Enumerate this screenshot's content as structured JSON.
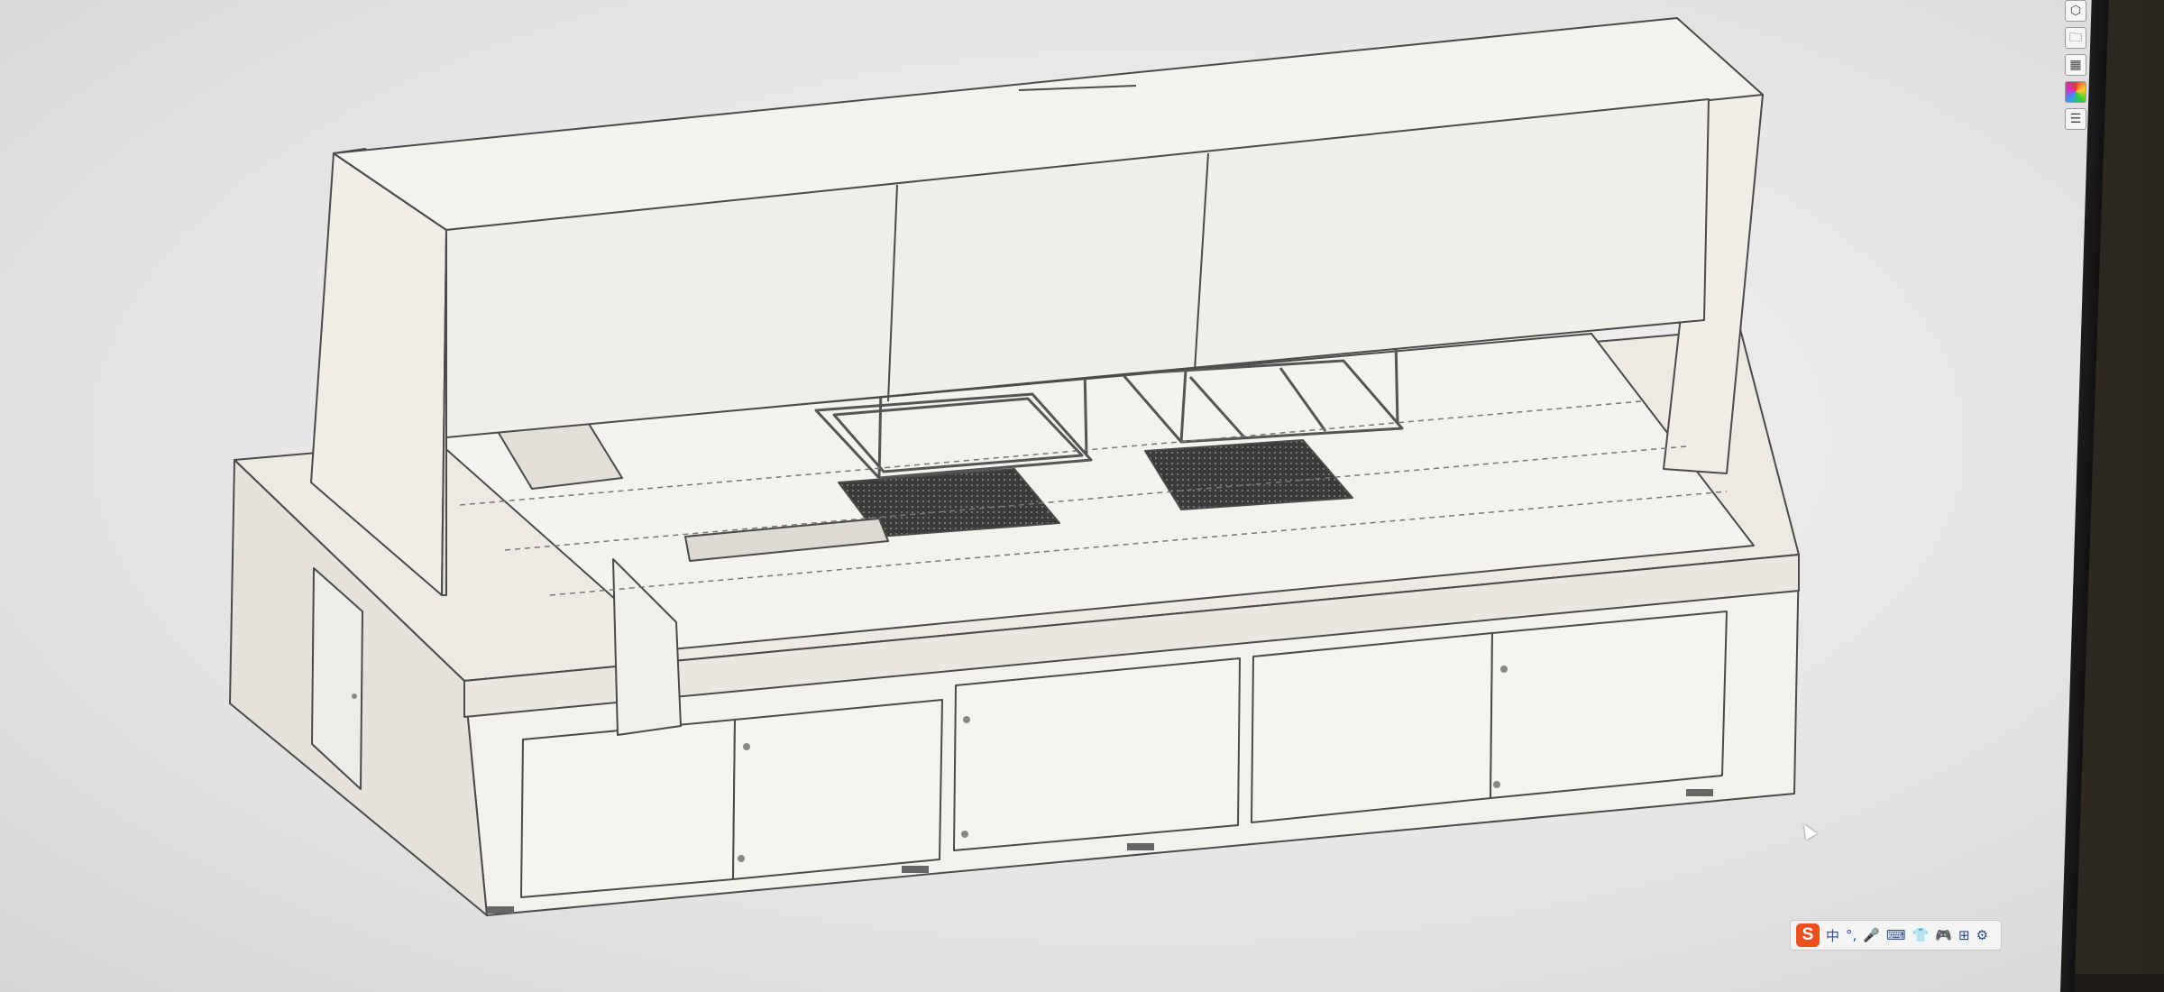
{
  "app": {
    "title": "",
    "viewport_background": "#e8e8e8",
    "model_fill": "#eceae3",
    "model_stroke": "#4a4a4a",
    "grate_fill": "#333333"
  },
  "toolbar": {
    "items": [
      {
        "icon": "cube-view-icon",
        "glyph": "⬡"
      },
      {
        "icon": "open-folder-icon",
        "glyph": "🗀"
      },
      {
        "icon": "render-settings-icon",
        "glyph": "▦"
      },
      {
        "icon": "color-wheel-icon",
        "glyph": ""
      },
      {
        "icon": "properties-list-icon",
        "glyph": "☰"
      }
    ]
  },
  "ime_bar": {
    "logo": "S",
    "mode_label": "中",
    "punctuation_symbol": "°,",
    "icons": [
      "microphone-icon",
      "keyboard-icon",
      "skin-icon",
      "game-icon",
      "toolbox-icon",
      "settings-icon"
    ],
    "glyphs": [
      "🎤",
      "⌨",
      "👕",
      "🎮",
      "⊞",
      "⚙"
    ]
  }
}
